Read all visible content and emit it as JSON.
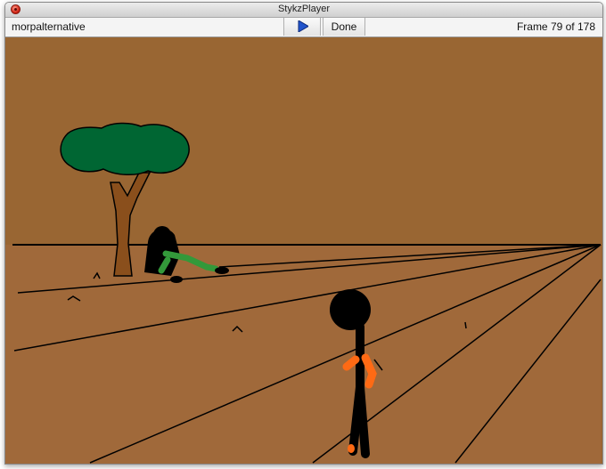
{
  "window": {
    "title": "StykzPlayer"
  },
  "toolbar": {
    "animation_name": "morpalternative",
    "play_icon": "play-triangle-icon",
    "done_label": "Done",
    "frame_counter": "Frame 79 of 178"
  },
  "colors": {
    "sky": "#996633",
    "ground": "#a0693a",
    "tree_leaves": "#006633",
    "tree_trunk": "#8a4f1c",
    "figure": "#000000",
    "green_figure": "#33993a",
    "orange_accent": "#ff6a14",
    "play_icon": "#2255cc"
  }
}
